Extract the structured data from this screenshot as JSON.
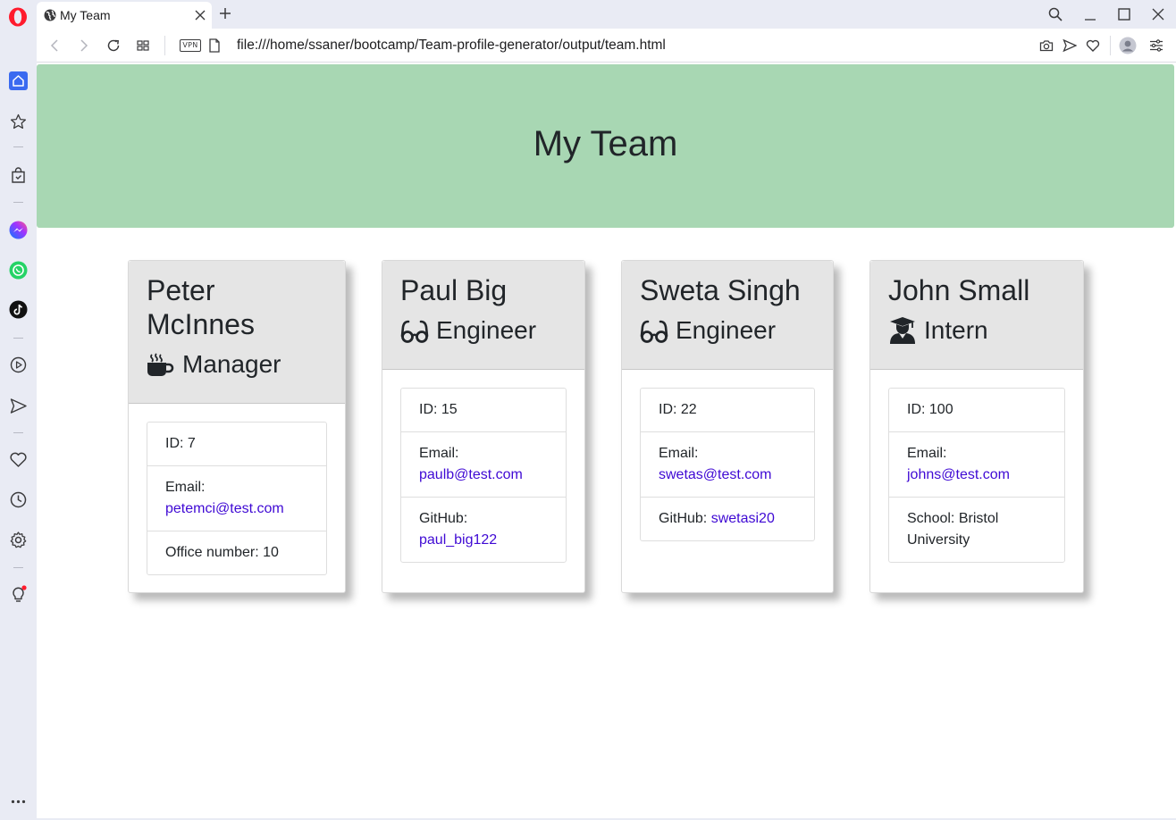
{
  "browser": {
    "tab_title": "My Team",
    "url": "file:///home/ssaner/bootcamp/Team-profile-generator/output/team.html",
    "vpn_label": "VPN"
  },
  "sidebar": {
    "icons": [
      "home-icon",
      "speed-dial-icon",
      "shopping-bag-icon",
      "messenger-icon",
      "whatsapp-icon",
      "tiktok-icon",
      "player-icon",
      "send-icon",
      "heart-icon",
      "history-icon",
      "settings-icon",
      "lightbulb-icon",
      "more-icon"
    ]
  },
  "page": {
    "title": "My Team",
    "header_color": "#a8d7b3",
    "link_color": "#3f09d4"
  },
  "team": [
    {
      "name": "Peter McInnes",
      "role": "Manager",
      "role_icon": "mug-icon",
      "id_text": "ID: 7",
      "email_label": "Email:",
      "email": "petemci@test.com",
      "extra_label": "Office number: 10",
      "extra_link": ""
    },
    {
      "name": "Paul Big",
      "role": "Engineer",
      "role_icon": "glasses-icon",
      "id_text": "ID: 15",
      "email_label": "Email:",
      "email": "paulb@test.com",
      "extra_label": "GitHub:",
      "extra_link": "paul_big122"
    },
    {
      "name": "Sweta Singh",
      "role": "Engineer",
      "role_icon": "glasses-icon",
      "id_text": "ID: 22",
      "email_label": "Email:",
      "email": "swetas@test.com",
      "extra_label": "GitHub:",
      "extra_link": "swetasi20"
    },
    {
      "name": "John Small",
      "role": "Intern",
      "role_icon": "graduate-icon",
      "id_text": "ID: 100",
      "email_label": "Email:",
      "email": "johns@test.com",
      "extra_label": "School: Bristol University",
      "extra_link": ""
    }
  ]
}
